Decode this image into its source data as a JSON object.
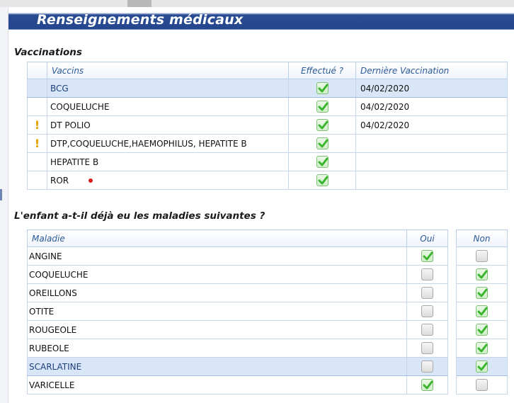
{
  "header": {
    "title": "Renseignements médicaux"
  },
  "vaccinations": {
    "section_title": "Vaccinations",
    "columns": {
      "vaccine": "Vaccins",
      "done": "Effectué ?",
      "last": "Dernière Vaccination"
    },
    "rows": [
      {
        "name": "BCG",
        "done": true,
        "last": "04/02/2020",
        "warning": false,
        "red_dot": false,
        "selected": true
      },
      {
        "name": "COQUELUCHE",
        "done": true,
        "last": "04/02/2020",
        "warning": false,
        "red_dot": false,
        "selected": false
      },
      {
        "name": "DT POLIO",
        "done": true,
        "last": "04/02/2020",
        "warning": true,
        "red_dot": false,
        "selected": false
      },
      {
        "name": "DTP,COQUELUCHE,HAEMOPHILUS, HEPATITE B",
        "done": true,
        "last": "",
        "warning": true,
        "red_dot": false,
        "selected": false
      },
      {
        "name": "HEPATITE B",
        "done": true,
        "last": "",
        "warning": false,
        "red_dot": false,
        "selected": false
      },
      {
        "name": "ROR",
        "done": true,
        "last": "",
        "warning": false,
        "red_dot": true,
        "selected": false
      }
    ]
  },
  "diseases": {
    "section_title": "L'enfant a-t-il déjà eu les maladies suivantes ?",
    "columns": {
      "disease": "Maladie",
      "yes": "Oui",
      "no": "Non"
    },
    "rows": [
      {
        "name": "ANGINE",
        "yes": true,
        "no": false,
        "selected": false
      },
      {
        "name": "COQUELUCHE",
        "yes": false,
        "no": true,
        "selected": false
      },
      {
        "name": "OREILLONS",
        "yes": false,
        "no": true,
        "selected": false
      },
      {
        "name": "OTITE",
        "yes": false,
        "no": true,
        "selected": false
      },
      {
        "name": "ROUGEOLE",
        "yes": false,
        "no": true,
        "selected": false
      },
      {
        "name": "RUBEOLE",
        "yes": false,
        "no": true,
        "selected": false
      },
      {
        "name": "SCARLATINE",
        "yes": false,
        "no": true,
        "selected": true
      },
      {
        "name": "VARICELLE",
        "yes": true,
        "no": false,
        "selected": false
      }
    ]
  },
  "colors": {
    "header_bg": "#25468c",
    "selected_row": "#d8e6f7",
    "check": "#3bb52e",
    "warning": "#e6a300",
    "dot": "#d81b1b"
  }
}
